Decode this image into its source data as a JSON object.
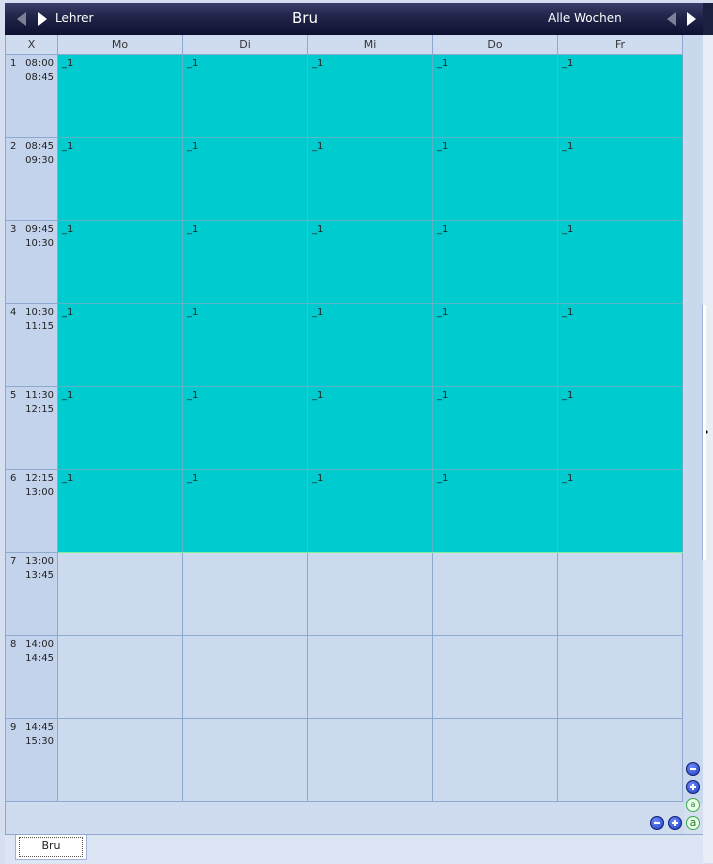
{
  "topbar": {
    "left_label": "Lehrer",
    "title": "Bru",
    "right_label": "Alle Wochen"
  },
  "grid": {
    "corner_label": "X",
    "days": [
      "Mo",
      "Di",
      "Mi",
      "Do",
      "Fr"
    ],
    "periods": [
      {
        "num": "1",
        "start": "08:00",
        "end": "08:45",
        "cells": [
          "_1",
          "_1",
          "_1",
          "_1",
          "_1"
        ]
      },
      {
        "num": "2",
        "start": "08:45",
        "end": "09:30",
        "cells": [
          "_1",
          "_1",
          "_1",
          "_1",
          "_1"
        ]
      },
      {
        "num": "3",
        "start": "09:45",
        "end": "10:30",
        "cells": [
          "_1",
          "_1",
          "_1",
          "_1",
          "_1"
        ]
      },
      {
        "num": "4",
        "start": "10:30",
        "end": "11:15",
        "cells": [
          "_1",
          "_1",
          "_1",
          "_1",
          "_1"
        ]
      },
      {
        "num": "5",
        "start": "11:30",
        "end": "12:15",
        "cells": [
          "_1",
          "_1",
          "_1",
          "_1",
          "_1"
        ]
      },
      {
        "num": "6",
        "start": "12:15",
        "end": "13:00",
        "cells": [
          "_1",
          "_1",
          "_1",
          "_1",
          "_1"
        ]
      },
      {
        "num": "7",
        "start": "13:00",
        "end": "13:45",
        "cells": [
          "",
          "",
          "",
          "",
          ""
        ]
      },
      {
        "num": "8",
        "start": "14:00",
        "end": "14:45",
        "cells": [
          "",
          "",
          "",
          "",
          ""
        ]
      },
      {
        "num": "9",
        "start": "14:45",
        "end": "15:30",
        "cells": [
          "",
          "",
          "",
          "",
          ""
        ]
      }
    ]
  },
  "controls": {
    "font_small_glyph": "a",
    "font_large_glyph": "a"
  },
  "tabs": [
    {
      "label": "Bru"
    }
  ],
  "colors": {
    "lesson_fill": "#00cccf",
    "empty_fill": "#ccdaee",
    "header_bar": "#0d1030"
  }
}
